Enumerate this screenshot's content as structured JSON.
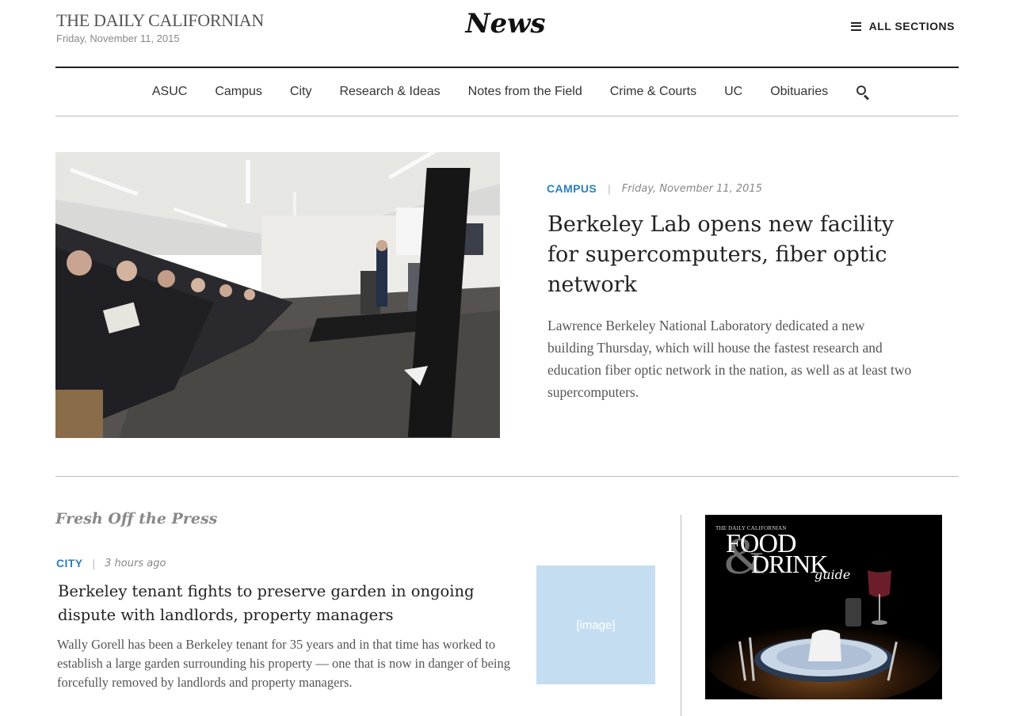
{
  "header": {
    "masthead": "THE DAILY CALIFORNIAN",
    "date": "Friday, November 11, 2015",
    "section_title": "News",
    "all_sections_label": "ALL SECTIONS"
  },
  "nav": {
    "items": [
      "ASUC",
      "Campus",
      "City",
      "Research & Ideas",
      "Notes from the Field",
      "Crime & Courts",
      "UC",
      "Obituaries"
    ],
    "icons": {
      "search": "search-icon",
      "menu": "hamburger-menu-icon"
    }
  },
  "featured": {
    "category": "CAMPUS",
    "separator": "|",
    "date": "Friday, November 11, 2015",
    "headline": "Berkeley Lab opens new facility for supercomputers, fiber optic network",
    "summary": "Lawrence Berkeley National Laboratory dedicated a new building Thursday, which will house the fastest research and education fiber optic network in the nation, as well as at least two supercomputers."
  },
  "fresh": {
    "title": "Fresh Off the Press",
    "story": {
      "category": "CITY",
      "separator": "|",
      "time": "3 hours ago",
      "headline": "Berkeley tenant fights to preserve garden in ongoing dispute with landlords, property managers",
      "summary": "Wally Gorell has been a Berkeley tenant for 35 years and in that time has worked to establish a large garden surrounding his property — one that is now in danger of being forcefully removed by landlords and property managers.",
      "thumb_label": "[image]"
    }
  },
  "ad": {
    "brand": "THE DAILY CALIFORNIAN",
    "line1": "FOOD",
    "amp": "&",
    "line2": "DRINK",
    "line3": "guide"
  },
  "colors": {
    "accent": "#2a7fc0",
    "thumb_placeholder": "#c5ddf0"
  }
}
